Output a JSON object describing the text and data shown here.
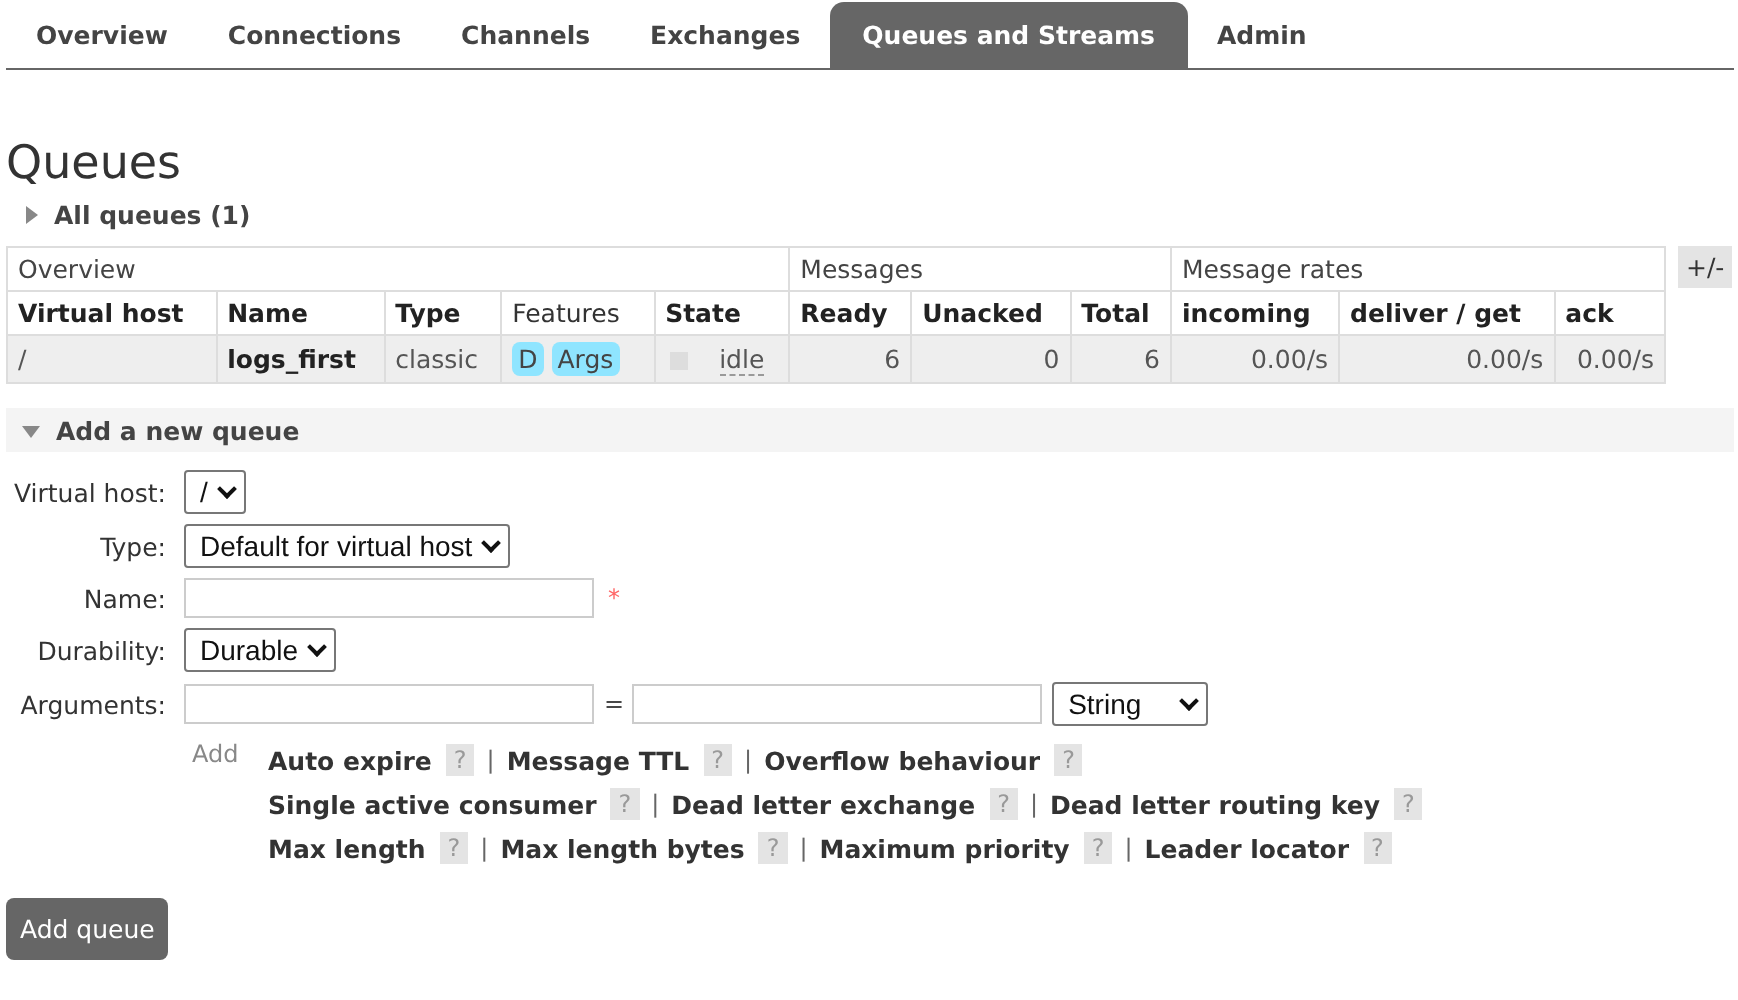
{
  "tabs": [
    {
      "label": "Overview",
      "selected": false
    },
    {
      "label": "Connections",
      "selected": false
    },
    {
      "label": "Channels",
      "selected": false
    },
    {
      "label": "Exchanges",
      "selected": false
    },
    {
      "label": "Queues and Streams",
      "selected": true
    },
    {
      "label": "Admin",
      "selected": false
    }
  ],
  "page_title": "Queues",
  "all_queues": {
    "label": "All queues (1)",
    "expanded": false
  },
  "queue_table": {
    "groups": [
      {
        "label": "Overview",
        "columns": [
          {
            "label": "Virtual host",
            "bold": true
          },
          {
            "label": "Name",
            "bold": true
          },
          {
            "label": "Type",
            "bold": true
          },
          {
            "label": "Features",
            "bold": false
          },
          {
            "label": "State",
            "bold": true
          }
        ]
      },
      {
        "label": "Messages",
        "columns": [
          {
            "label": "Ready",
            "bold": true
          },
          {
            "label": "Unacked",
            "bold": true
          },
          {
            "label": "Total",
            "bold": true
          }
        ]
      },
      {
        "label": "Message rates",
        "columns": [
          {
            "label": "incoming",
            "bold": true
          },
          {
            "label": "deliver / get",
            "bold": true
          },
          {
            "label": "ack",
            "bold": true
          }
        ]
      }
    ],
    "toggle": "+/-",
    "rows": [
      {
        "cells": [
          {
            "kind": "text",
            "text": "/"
          },
          {
            "kind": "bold",
            "text": "logs_first"
          },
          {
            "kind": "text",
            "text": "classic"
          },
          {
            "kind": "features",
            "tags": [
              "D",
              "Args"
            ]
          },
          {
            "kind": "state",
            "text": "idle"
          },
          {
            "kind": "number",
            "text": "6"
          },
          {
            "kind": "number",
            "text": "0"
          },
          {
            "kind": "number",
            "text": "6"
          },
          {
            "kind": "number",
            "text": "0.00/s"
          },
          {
            "kind": "number",
            "text": "0.00/s"
          },
          {
            "kind": "number",
            "text": "0.00/s"
          }
        ]
      }
    ]
  },
  "add_queue": {
    "title": "Add a new queue",
    "expanded": true,
    "fields": [
      {
        "label": "Virtual host:",
        "kind": "select",
        "value": "/"
      },
      {
        "label": "Type:",
        "kind": "select",
        "value": "Default for virtual host"
      },
      {
        "label": "Name:",
        "kind": "input",
        "required_mark": "*"
      },
      {
        "label": "Durability:",
        "kind": "select",
        "value": "Durable"
      },
      {
        "label": "Arguments:",
        "kind": "args",
        "equals": "=",
        "value_type": "String"
      }
    ],
    "add_label": "Add",
    "argument_hints": [
      [
        "Auto expire",
        "Message TTL",
        "Overflow behaviour"
      ],
      [
        "Single active consumer",
        "Dead letter exchange",
        "Dead letter routing key"
      ],
      [
        "Max length",
        "Max length bytes",
        "Maximum priority",
        "Leader locator"
      ]
    ],
    "help": "?",
    "separator": "|",
    "button": "Add queue"
  }
}
